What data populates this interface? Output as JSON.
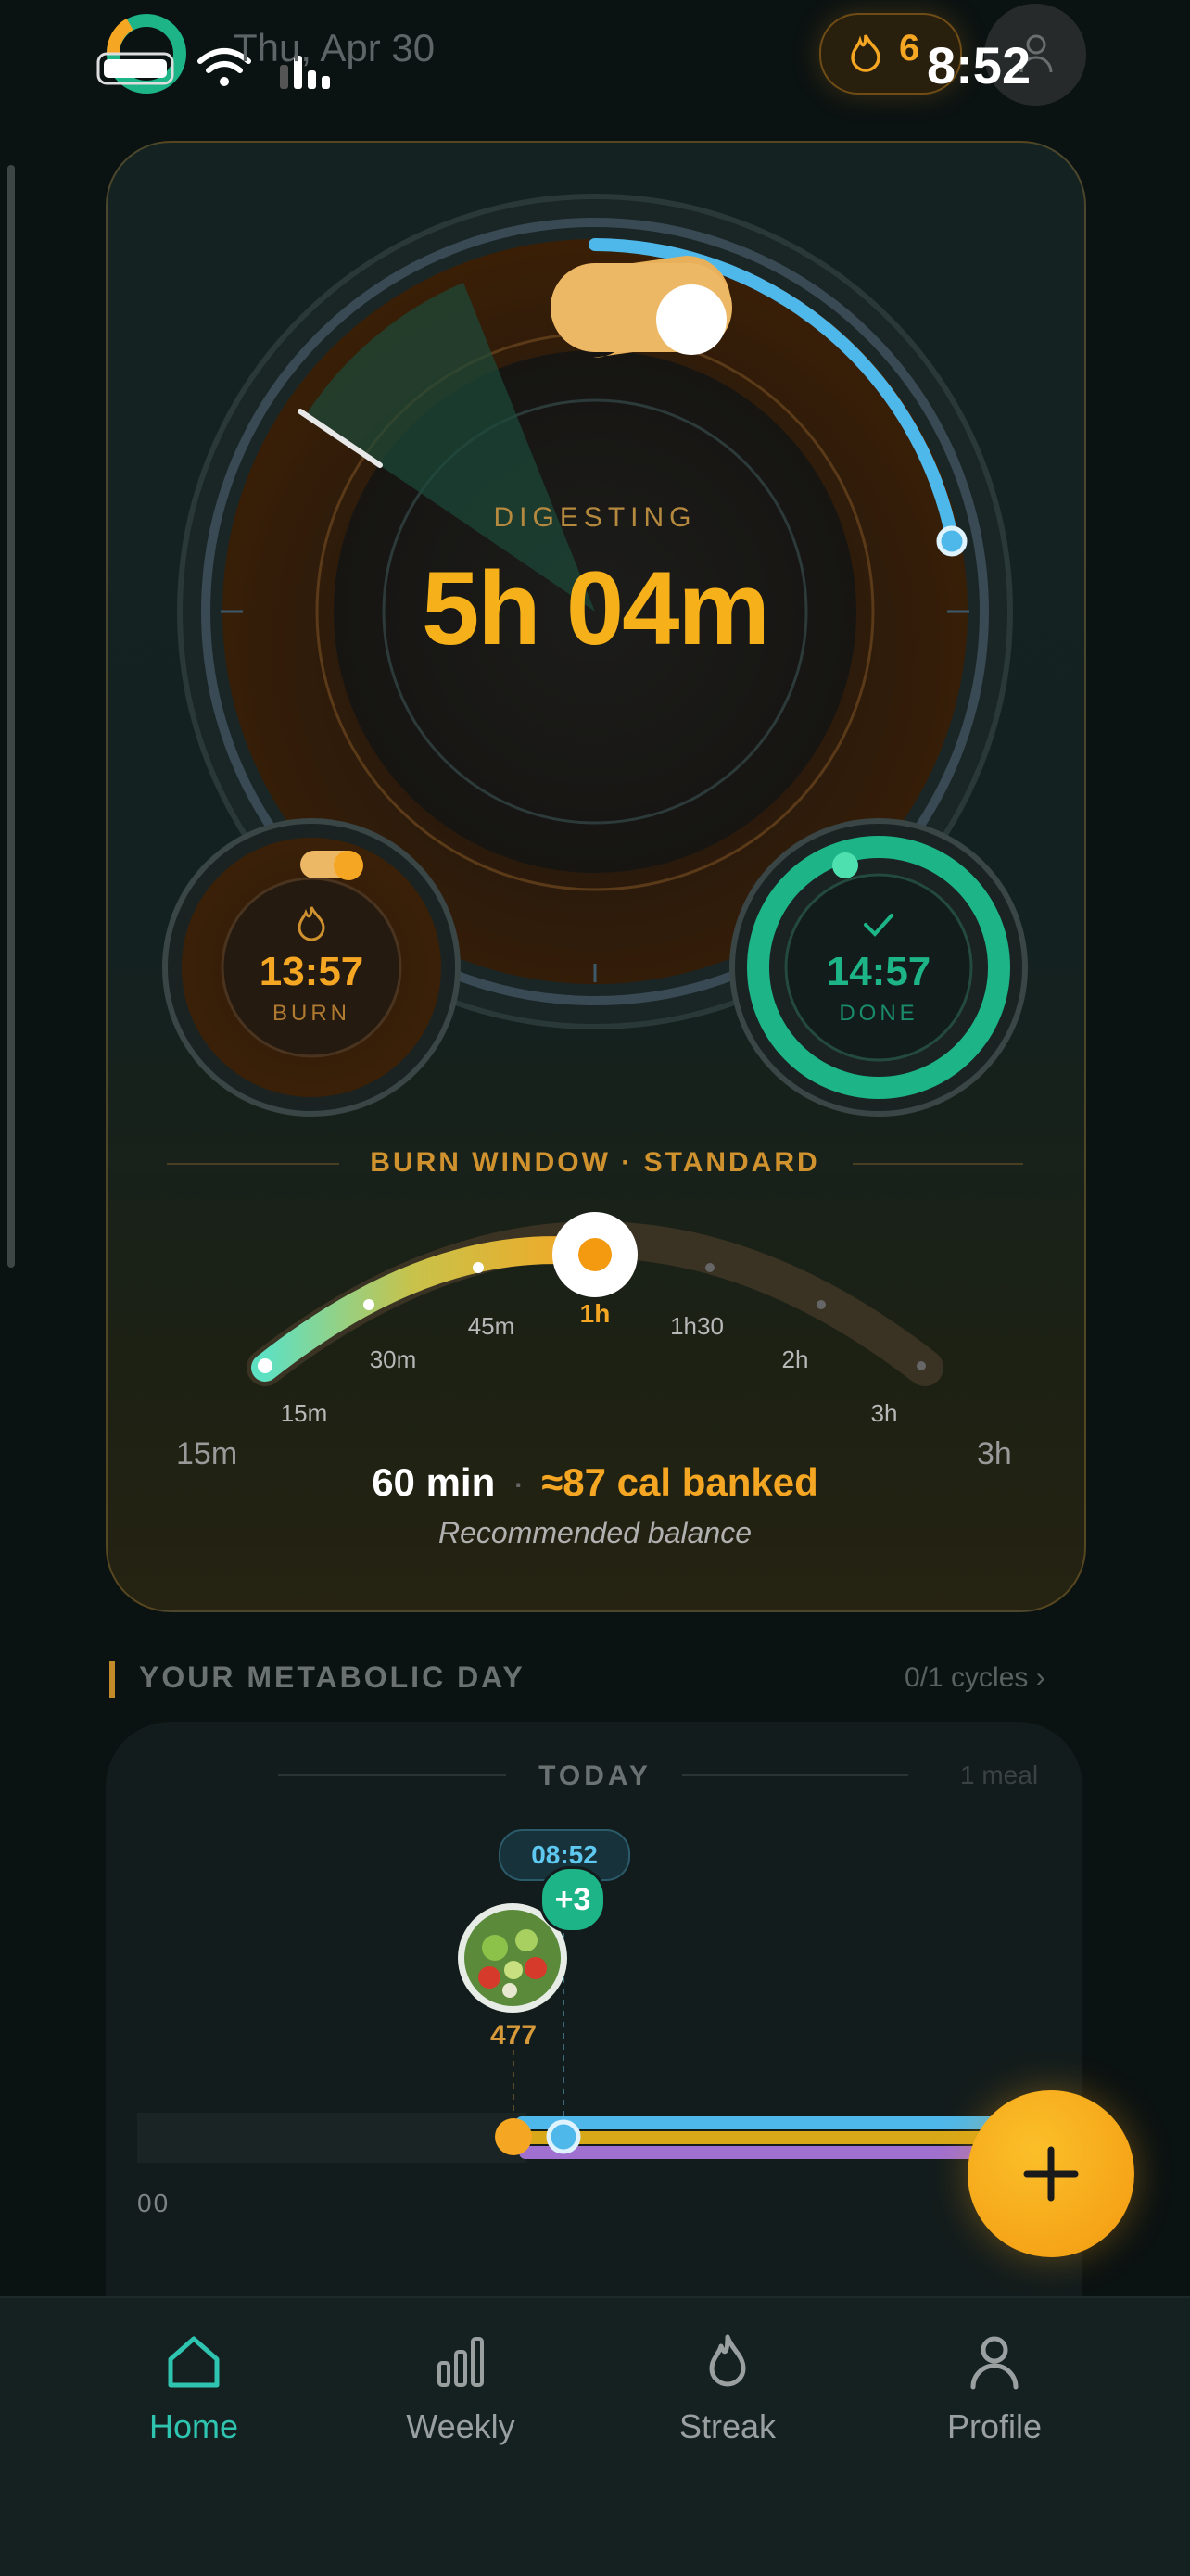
{
  "status_bar": {
    "time": "8:52",
    "date": "Thu, Apr 30"
  },
  "header": {
    "streak_count": "6"
  },
  "dial": {
    "state_label": "DIGESTING",
    "elapsed": "5h 04m",
    "burn": {
      "time": "13:57",
      "label": "BURN"
    },
    "done": {
      "time": "14:57",
      "label": "DONE"
    }
  },
  "burn_window": {
    "title": "BURN WINDOW · STANDARD",
    "ticks": [
      "15m",
      "30m",
      "45m",
      "1h",
      "1h30",
      "2h",
      "3h"
    ],
    "selected": "1h",
    "range_min": "15m",
    "range_max": "3h",
    "minutes": "60 min",
    "calories": "≈87 cal banked",
    "hint": "Recommended balance"
  },
  "metabolic_day": {
    "title": "YOUR METABOLIC DAY",
    "cycles": "0/1 cycles",
    "day_label": "TODAY",
    "meal_count": "1 meal",
    "current_time": "08:52",
    "extra_badge": "+3",
    "meal_calories": "477",
    "hour_start": "00"
  },
  "nav": {
    "items": [
      {
        "label": "Home"
      },
      {
        "label": "Weekly"
      },
      {
        "label": "Streak"
      },
      {
        "label": "Profile"
      }
    ]
  },
  "colors": {
    "accent": "#f5a623",
    "teal": "#2ec4b0",
    "blue": "#4fb8ea",
    "green": "#1db488"
  }
}
